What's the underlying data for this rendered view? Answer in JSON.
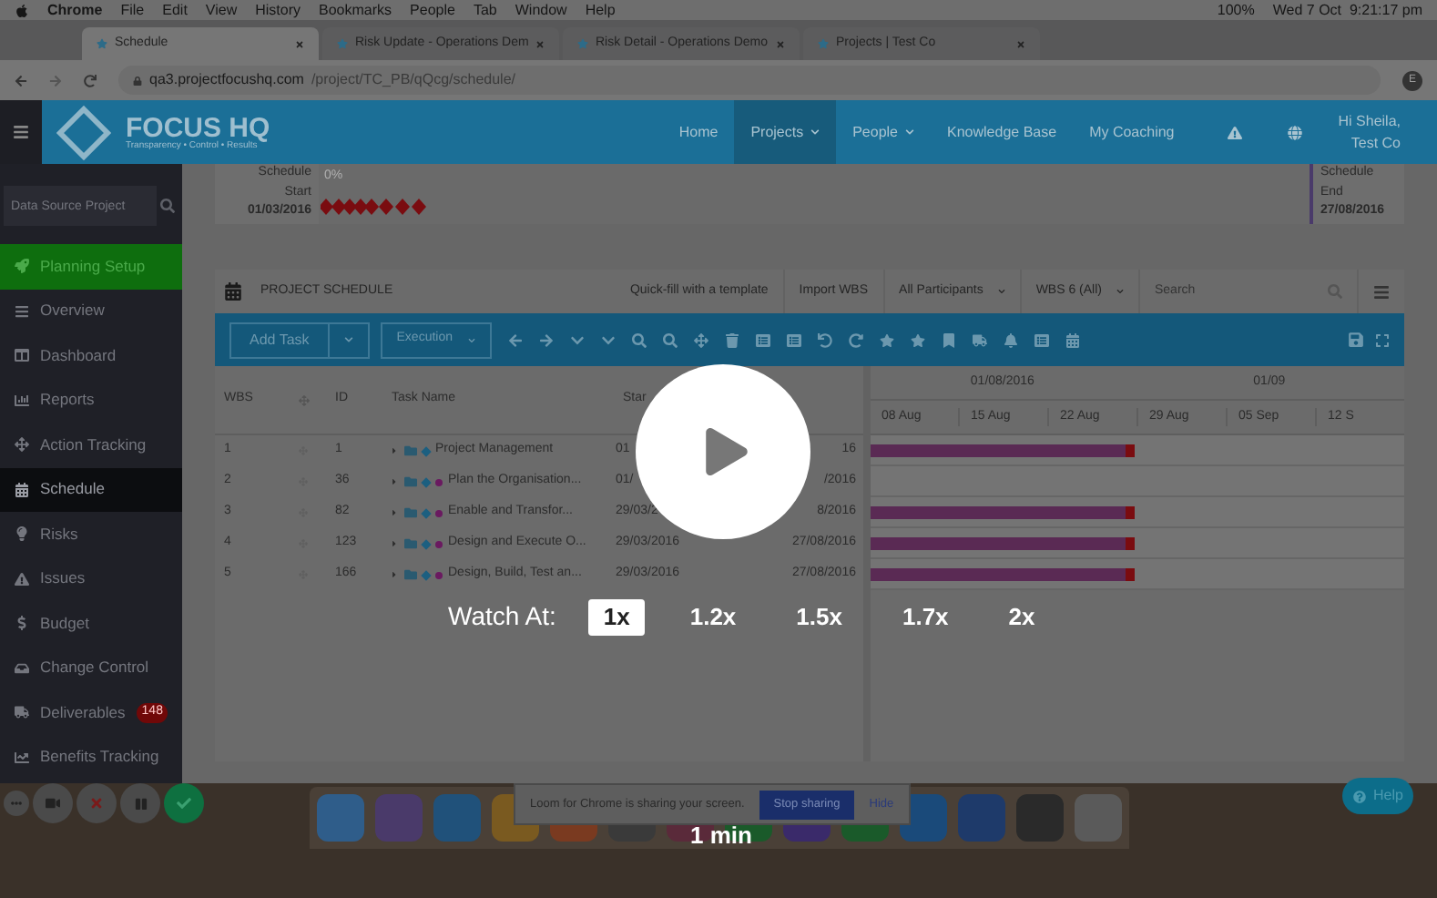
{
  "menu_bar": {
    "app": "Chrome",
    "items": [
      "File",
      "Edit",
      "View",
      "History",
      "Bookmarks",
      "People",
      "Tab",
      "Window",
      "Help"
    ],
    "battery": "100%",
    "clock": "Wed 7 Oct  9:21:17 pm"
  },
  "browser_tabs": [
    {
      "title": "Schedule",
      "selected": true
    },
    {
      "title": "Risk Update - Operations Dem",
      "selected": false
    },
    {
      "title": "Risk Detail - Operations Demo",
      "selected": false
    },
    {
      "title": "Projects | Test Co",
      "selected": false
    }
  ],
  "address_bar": {
    "domain": "qa3.projectfocushq.com",
    "path": "/project/TC_PB/qQcg/schedule/",
    "profile": "E"
  },
  "header": {
    "logo": "FOCUS HQ",
    "tagline": "Transparency • Control • Results",
    "nav": [
      {
        "label": "Home",
        "selected": false,
        "dropdown": false
      },
      {
        "label": "Projects",
        "selected": true,
        "dropdown": true
      },
      {
        "label": "People",
        "selected": false,
        "dropdown": true
      },
      {
        "label": "Knowledge Base",
        "selected": false,
        "dropdown": false
      },
      {
        "label": "My Coaching",
        "selected": false,
        "dropdown": false
      }
    ],
    "greeting": "Hi Sheila,",
    "company": "Test Co"
  },
  "sidebar": {
    "search_placeholder": "Data Source Project",
    "items": [
      {
        "label": "Planning Setup",
        "kind": "setup",
        "selected": false
      },
      {
        "label": "Overview",
        "kind": "link",
        "selected": false
      },
      {
        "label": "Dashboard",
        "kind": "link",
        "selected": false
      },
      {
        "label": "Reports",
        "kind": "link",
        "selected": false
      },
      {
        "label": "Action Tracking",
        "kind": "link",
        "selected": false
      },
      {
        "label": "Schedule",
        "kind": "link",
        "selected": true
      },
      {
        "label": "Risks",
        "kind": "link",
        "selected": false
      },
      {
        "label": "Issues",
        "kind": "link",
        "selected": false
      },
      {
        "label": "Budget",
        "kind": "link",
        "selected": false
      },
      {
        "label": "Change Control",
        "kind": "link",
        "selected": false
      },
      {
        "label": "Deliverables",
        "kind": "link",
        "selected": false,
        "badge": "148"
      },
      {
        "label": "Benefits Tracking",
        "kind": "link",
        "selected": false
      }
    ]
  },
  "schedule_strip": {
    "start_label": [
      "Schedule",
      "Start"
    ],
    "start_date": "01/03/2016",
    "progress": "0%",
    "end_label": [
      "Schedule",
      "End"
    ],
    "end_date": "27/08/2016"
  },
  "panel": {
    "title": "PROJECT SCHEDULE",
    "buttons": [
      "Quick-fill with a template",
      "Import WBS"
    ],
    "filters": [
      "All Participants",
      "WBS 6 (All)"
    ],
    "search_placeholder": "Search"
  },
  "toolbar": {
    "add_task": "Add Task",
    "view": "Execution"
  },
  "table": {
    "columns": [
      "WBS",
      "ID",
      "Task Name",
      "Star"
    ],
    "rows": [
      {
        "wbs": "1",
        "id": "1",
        "name": "Project Management",
        "flagged": false,
        "start": "01",
        "finish": "16",
        "bar": true
      },
      {
        "wbs": "2",
        "id": "36",
        "name": "Plan the Organisation...",
        "flagged": true,
        "start": "01/",
        "finish": "/2016",
        "bar": false
      },
      {
        "wbs": "3",
        "id": "82",
        "name": "Enable and Transfor...",
        "flagged": true,
        "start": "29/03/2",
        "finish": "8/2016",
        "bar": true
      },
      {
        "wbs": "4",
        "id": "123",
        "name": "Design and Execute O...",
        "flagged": true,
        "start": "29/03/2016",
        "finish": "27/08/2016",
        "bar": true
      },
      {
        "wbs": "5",
        "id": "166",
        "name": "Design, Build, Test an...",
        "flagged": true,
        "start": "29/03/2016",
        "finish": "27/08/2016",
        "bar": true
      }
    ]
  },
  "gantt": {
    "months": [
      "01/08/2016",
      "01/09"
    ],
    "weeks": [
      "08 Aug",
      "15 Aug",
      "22 Aug",
      "29 Aug",
      "05 Sep",
      "12 S"
    ]
  },
  "share_notice": {
    "text": "Loom for Chrome is sharing your screen.",
    "stop": "Stop sharing",
    "hide": "Hide"
  },
  "help": "Help",
  "player": {
    "label": "Watch At:",
    "speeds": [
      {
        "label": "1x",
        "selected": true
      },
      {
        "label": "1.2x",
        "selected": false
      },
      {
        "label": "1.5x",
        "selected": false
      },
      {
        "label": "1.7x",
        "selected": false
      },
      {
        "label": "2x",
        "selected": false
      }
    ],
    "duration": "1 min"
  }
}
